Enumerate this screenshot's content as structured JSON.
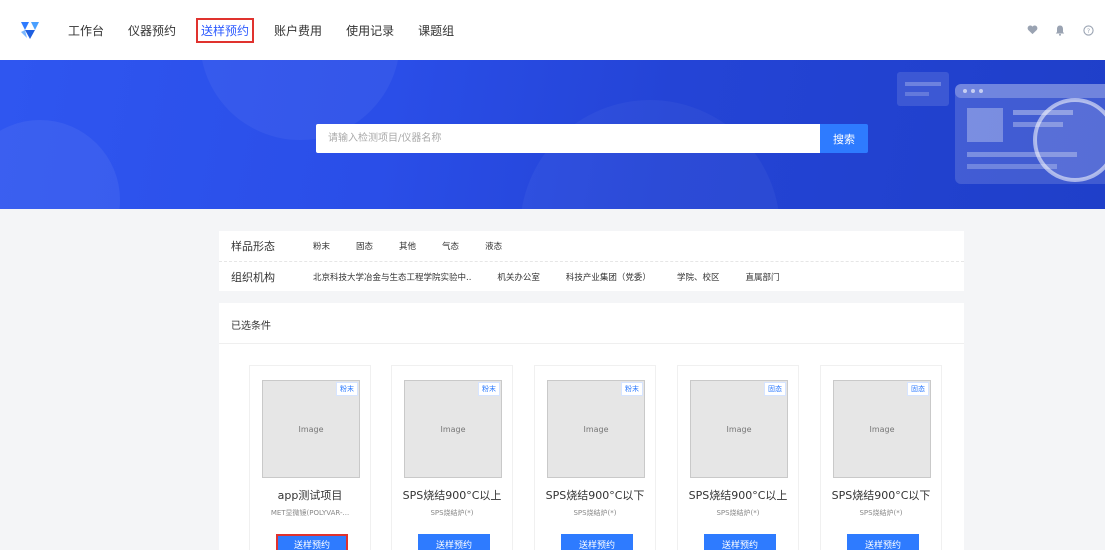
{
  "nav": {
    "items": [
      {
        "label": "工作台"
      },
      {
        "label": "仪器预约"
      },
      {
        "label": "送样预约"
      },
      {
        "label": "账户费用"
      },
      {
        "label": "使用记录"
      },
      {
        "label": "课题组"
      }
    ],
    "active_index": 2
  },
  "search": {
    "placeholder": "请输入检测项目/仪器名称",
    "button_label": "搜索"
  },
  "filters": {
    "form": {
      "label": "样品形态",
      "options": [
        "粉末",
        "固态",
        "其他",
        "气态",
        "液态"
      ]
    },
    "org": {
      "label": "组织机构",
      "options": [
        "北京科技大学冶金与生态工程学院实验中..",
        "机关办公室",
        "科技产业集团（党委）",
        "学院、校区",
        "直属部门"
      ]
    }
  },
  "selected": {
    "title": "已选条件"
  },
  "cards": [
    {
      "tag": "粉末",
      "title": "app测试项目",
      "subtitle": "MET显微镜(POLYVAR-...",
      "button": "送样预约",
      "image": "microscope-photo"
    },
    {
      "tag": "粉末",
      "title": "SPS烧结900°C以上",
      "subtitle": "SPS烧结炉(*)",
      "button": "送样预约",
      "image": "sps-furnace-photo"
    },
    {
      "tag": "粉末",
      "title": "SPS烧结900°C以下",
      "subtitle": "SPS烧结炉(*)",
      "button": "送样预约",
      "image": "sps-furnace-photo"
    },
    {
      "tag": "固态",
      "title": "SPS烧结900°C以上",
      "subtitle": "SPS烧结炉(*)",
      "button": "送样预约",
      "image": "sps-furnace-photo"
    },
    {
      "tag": "固态",
      "title": "SPS烧结900°C以下",
      "subtitle": "SPS烧结炉(*)",
      "button": "送样预约",
      "image": "sps-furnace-photo"
    }
  ],
  "colors": {
    "primary": "#2e7bff",
    "highlight_outline": "#e0322e",
    "banner": "#2a4ee8"
  }
}
